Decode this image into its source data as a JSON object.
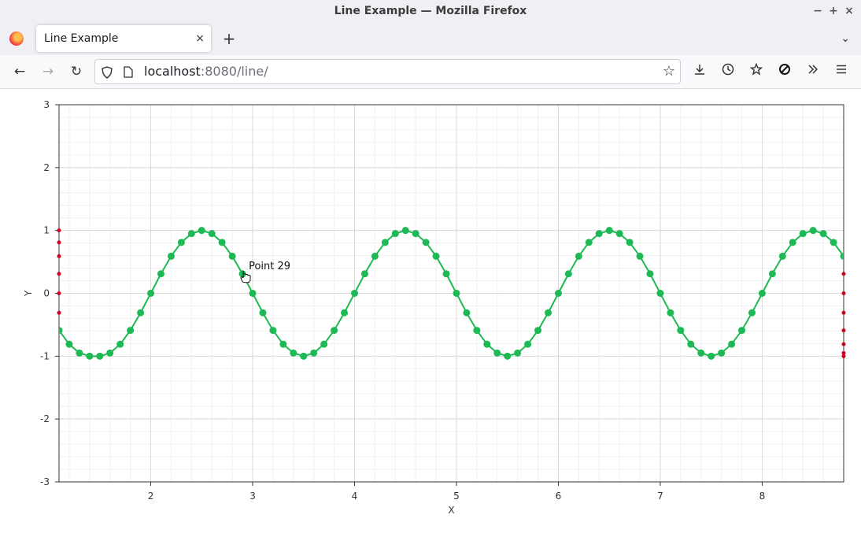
{
  "window": {
    "title": "Line Example — Mozilla Firefox",
    "controls": [
      "−",
      "+",
      "×"
    ]
  },
  "tabs": [
    {
      "label": "Line Example",
      "close": "×"
    }
  ],
  "toolbar": {
    "new_tab": "+",
    "tab_list": "⌄"
  },
  "nav": {
    "back": "←",
    "forward": "→",
    "reload": "↻",
    "url_host": "localhost",
    "url_rest": ":8080/line/",
    "right_icons": [
      "download-icon",
      "history-icon",
      "extensions-icon",
      "blocker-icon",
      "overflow-icon",
      "menu-icon"
    ]
  },
  "colors": {
    "line": "#1db954",
    "edge_marker": "#d0021b"
  },
  "tooltip": {
    "text": "Point 29"
  },
  "chart_data": {
    "type": "line",
    "xlabel": "X",
    "ylabel": "Y",
    "xlim": [
      1.1,
      8.8
    ],
    "ylim": [
      -3,
      3
    ],
    "xticks": [
      2,
      3,
      4,
      5,
      6,
      7,
      8
    ],
    "yticks": [
      3,
      2,
      1,
      0,
      -1,
      -2,
      -3
    ],
    "grid": true,
    "series": [
      {
        "x": [
          1.1,
          1.2,
          1.3,
          1.4,
          1.5,
          1.6,
          1.7,
          1.8,
          1.9,
          2.0,
          2.1,
          2.2,
          2.3,
          2.4,
          2.5,
          2.6,
          2.7,
          2.8,
          2.9,
          3.0,
          3.1,
          3.2,
          3.3,
          3.4,
          3.5,
          3.6,
          3.7,
          3.8,
          3.9,
          4.0,
          4.1,
          4.2,
          4.3,
          4.4,
          4.5,
          4.6,
          4.7,
          4.8,
          4.9,
          5.0,
          5.1,
          5.2,
          5.3,
          5.4,
          5.5,
          5.6,
          5.7,
          5.8,
          5.9,
          6.0,
          6.1,
          6.2,
          6.3,
          6.4,
          6.5,
          6.6,
          6.7,
          6.8,
          6.9,
          7.0,
          7.1,
          7.2,
          7.3,
          7.4,
          7.5,
          7.6,
          7.7,
          7.8,
          7.9,
          8.0,
          8.1,
          8.2,
          8.3,
          8.4,
          8.5,
          8.6,
          8.7,
          8.8
        ],
        "y": [
          -0.59,
          -0.81,
          -0.95,
          -1.0,
          -1.0,
          -0.95,
          -0.81,
          -0.59,
          -0.31,
          0.0,
          0.31,
          0.59,
          0.81,
          0.95,
          1.0,
          0.95,
          0.81,
          0.59,
          0.31,
          0.0,
          -0.31,
          -0.59,
          -0.81,
          -0.95,
          -1.0,
          -0.95,
          -0.81,
          -0.59,
          -0.31,
          0.0,
          0.31,
          0.59,
          0.81,
          0.95,
          1.0,
          0.95,
          0.81,
          0.59,
          0.31,
          0.0,
          -0.31,
          -0.59,
          -0.81,
          -0.95,
          -1.0,
          -0.95,
          -0.81,
          -0.59,
          -0.31,
          0.0,
          0.31,
          0.59,
          0.81,
          0.95,
          1.0,
          0.95,
          0.81,
          0.59,
          0.31,
          0.0,
          -0.31,
          -0.59,
          -0.81,
          -0.95,
          -1.0,
          -0.95,
          -0.81,
          -0.59,
          -0.31,
          0.0,
          0.31,
          0.59,
          0.81,
          0.95,
          1.0,
          0.95,
          0.81,
          0.59
        ]
      }
    ],
    "edge_markers": {
      "left_y": [
        1.0,
        0.81,
        0.59,
        0.31,
        0.0,
        -0.31
      ],
      "right_y": [
        0.31,
        0.0,
        -0.31,
        -0.59,
        -0.81,
        -0.95,
        -1.0
      ]
    }
  }
}
